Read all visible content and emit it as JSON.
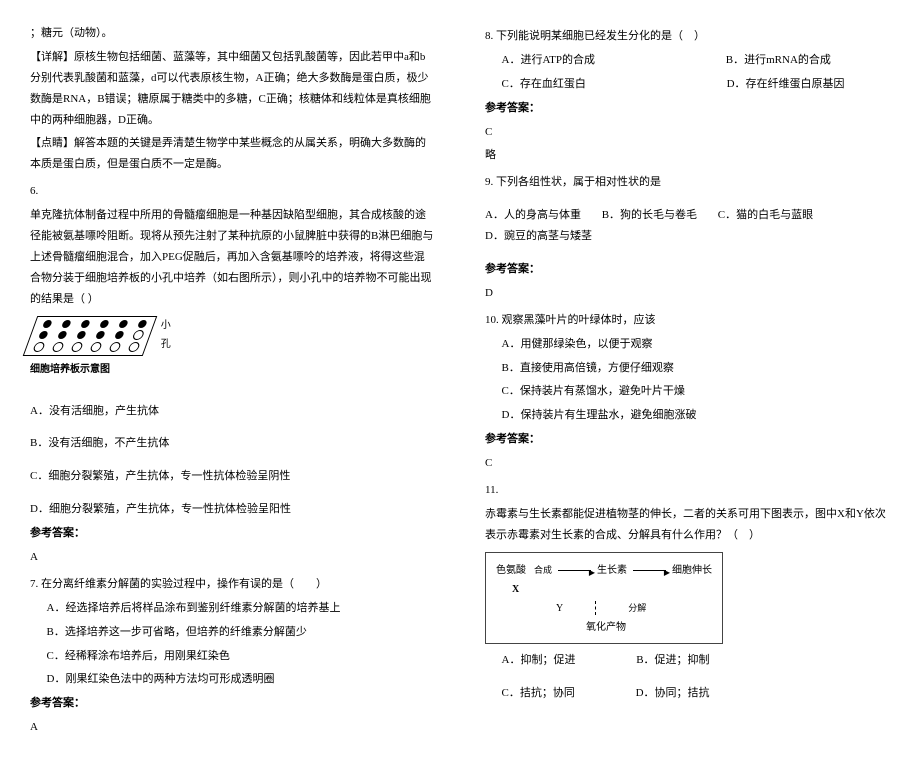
{
  "left": {
    "l1": "；糖元（动物）。",
    "l2": "【详解】原核生物包括细菌、蓝藻等，其中细菌又包括乳酸菌等，因此若甲中a和b分别代表乳酸菌和蓝藻，d可以代表原核生物，A正确；绝大多数酶是蛋白质，极少数酶是RNA，B错误；糖原属于糖类中的多糖，C正确；核糖体和线粒体是真核细胞中的两种细胞器，D正确。",
    "l3": "【点睛】解答本题的关键是弄清楚生物学中某些概念的从属关系，明确大多数酶的本质是蛋白质，但是蛋白质不一定是酶。",
    "q6": "6.",
    "q6body": "单克隆抗体制备过程中所用的骨髓瘤细胞是一种基因缺陷型细胞，其合成核酸的途径能被氨基嘌呤阻断。现将从预先注射了某种抗原的小鼠脾脏中获得的B淋巴细胞与上述骨髓瘤细胞混合，加入PEG促融后，再加入含氨基嘌呤的培养液，将得这些混合物分装于细胞培养板的小孔中培养（如右图所示），则小孔中的培养物不可能出现的结果是（  ）",
    "q6img_side": "小孔",
    "q6img_caption": "细胞培养板示意图",
    "q6A": "A．没有活细胞，产生抗体",
    "q6B": "B．没有活细胞，不产生抗体",
    "q6C": "C．细胞分裂繁殖，产生抗体，专一性抗体检验呈阴性",
    "q6D": "D．细胞分裂繁殖，产生抗体，专一性抗体检验呈阳性",
    "q6ansLabel": "参考答案：",
    "q6ans": "A",
    "q7": "7. 在分离纤维素分解菌的实验过程中，操作有误的是（　　）",
    "q7A": "A．经选择培养后将样品涂布到鉴别纤维素分解菌的培养基上",
    "q7B": "B．选择培养这一步可省略，但培养的纤维素分解菌少",
    "q7C": "C．经稀释涂布培养后，用刚果红染色",
    "q7D": "D．刚果红染色法中的两种方法均可形成透明圈",
    "q7ansLabel": "参考答案：",
    "q7ans": "A"
  },
  "right": {
    "q8": "8. 下列能说明某细胞已经发生分化的是（　）",
    "q8A": "A．进行ATP的合成",
    "q8B": "B．进行mRNA的合成",
    "q8C": "C．存在血红蛋白",
    "q8D": "D．存在纤维蛋白原基因",
    "q8ansLabel": "参考答案：",
    "q8ans": "C",
    "q8note": "略",
    "q9": "9. 下列各组性状，属于相对性状的是",
    "q9A": "A．人的身高与体重",
    "q9B": "B．狗的长毛与卷毛",
    "q9C": "C．猫的白毛与蓝眼",
    "q9D": "D．豌豆的高茎与矮茎",
    "q9ansLabel": "参考答案：",
    "q9ans": "D",
    "q10": "10. 观察黑藻叶片的叶绿体时，应该",
    "q10A": "A．用健那绿染色，以便于观察",
    "q10B": "B．直接使用高倍镜，方便仔细观察",
    "q10C": "C．保持装片有蒸馏水，避免叶片干燥",
    "q10D": "D．保持装片有生理盐水，避免细胞涨破",
    "q10ansLabel": "参考答案：",
    "q10ans": "C",
    "q11": "11.",
    "q11body": "赤霉素与生长素都能促进植物茎的伸长，二者的关系可用下图表示，图中X和Y依次表示赤霉素对生长素的合成、分解具有什么作用？（　）",
    "flow": {
      "a": "色氨酸",
      "b": "合成",
      "c": "生长素",
      "d": "细胞伸长",
      "x": "X",
      "y": "Y",
      "e": "分解",
      "f": "氧化产物"
    },
    "q11A": "A．抑制；促进",
    "q11B": "B．促进；抑制",
    "q11C": "C．拮抗；协同",
    "q11D": "D．协同；拮抗"
  }
}
